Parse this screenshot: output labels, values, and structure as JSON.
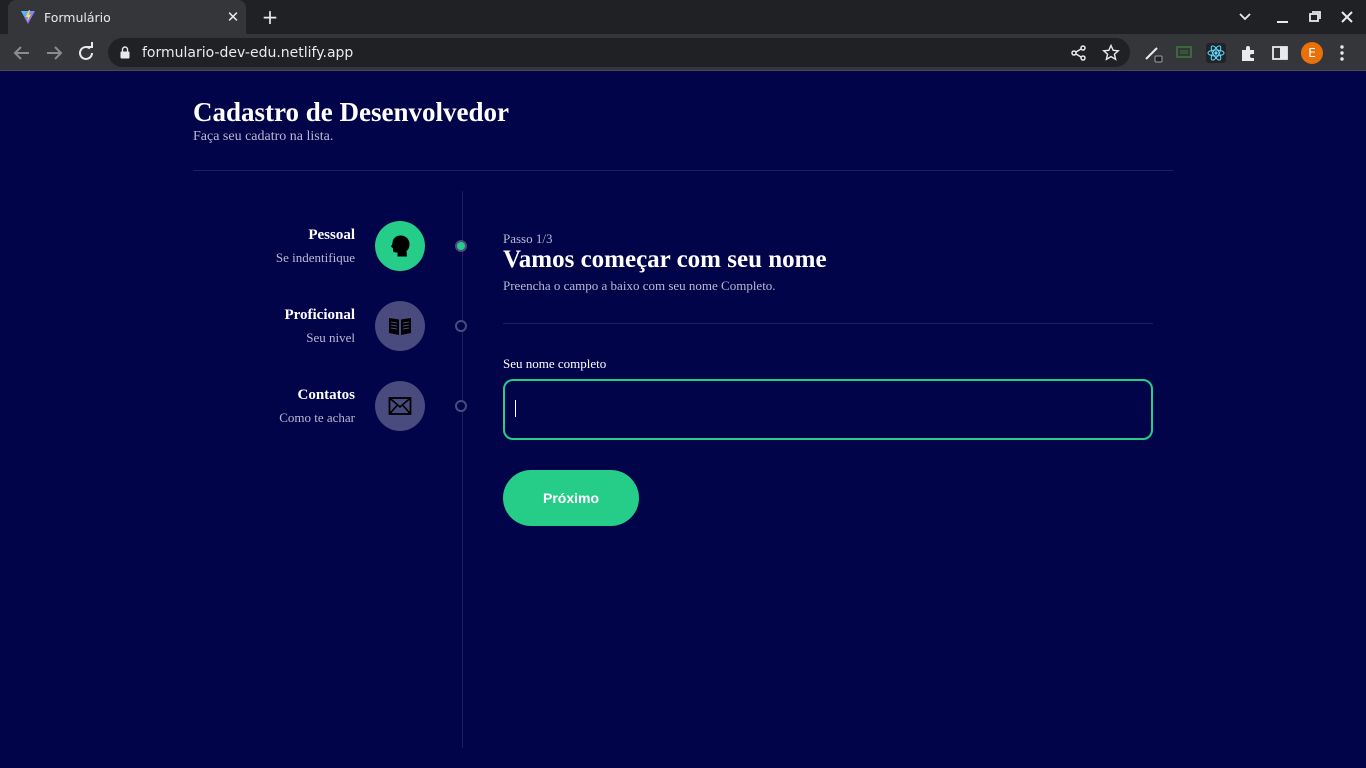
{
  "browser": {
    "tab_title": "Formulário",
    "url": "formulario-dev-edu.netlify.app",
    "profile_initial": "E",
    "icons": [
      "back-icon",
      "forward-icon",
      "reload-icon",
      "lock-icon",
      "share-icon",
      "bookmark-star-icon",
      "extensions-icon",
      "side-panel-icon",
      "menu-icon"
    ]
  },
  "header": {
    "title": "Cadastro de Desenvolvedor",
    "subtitle": "Faça seu cadatro na lista."
  },
  "steps": [
    {
      "title": "Pessoal",
      "subtitle": "Se indentifique",
      "icon": "head-silhouette-icon",
      "active": true
    },
    {
      "title": "Proficional",
      "subtitle": "Seu nivel",
      "icon": "open-book-icon",
      "active": false
    },
    {
      "title": "Contatos",
      "subtitle": "Como te achar",
      "icon": "envelope-icon",
      "active": false
    }
  ],
  "form": {
    "step_label": "Passo 1/3",
    "title": "Vamos começar com seu nome",
    "description": "Preencha o campo a baixo com seu nome Completo.",
    "field_label": "Seu nome completo",
    "field_value": "",
    "button_label": "Próximo"
  },
  "colors": {
    "background": "#02044a",
    "accent": "#25cd89",
    "inactive": "#494a7d",
    "muted_text": "#b8b9d0"
  }
}
